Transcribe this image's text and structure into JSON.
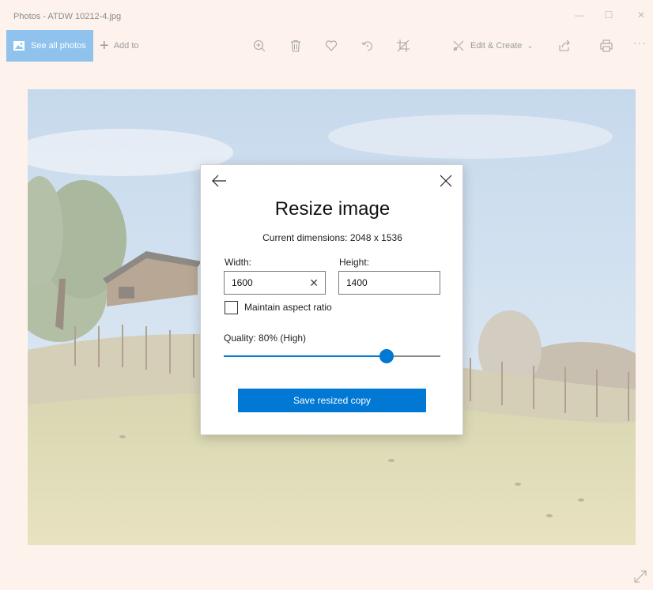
{
  "window": {
    "title": "Photos - ATDW 10212-4.jpg"
  },
  "toolbar": {
    "see_all_label": "See all photos",
    "add_to_label": "Add to",
    "edit_create_label": "Edit & Create",
    "icons": [
      "zoom-in-icon",
      "delete-icon",
      "heart-icon",
      "rotate-icon",
      "crop-icon",
      "share-icon",
      "print-icon",
      "more-icon"
    ],
    "accent": "#8fc3ed"
  },
  "dialog": {
    "title": "Resize image",
    "current_dimensions": "Current dimensions: 2048 x 1536",
    "width_label": "Width:",
    "width_value": "1600",
    "height_label": "Height:",
    "height_value": "1400",
    "maintain_aspect_label": "Maintain aspect ratio",
    "maintain_aspect_checked": false,
    "quality_label": "Quality: 80% (High)",
    "quality_value": 0.8,
    "save_label": "Save resized copy",
    "accent": "#0078d4"
  }
}
